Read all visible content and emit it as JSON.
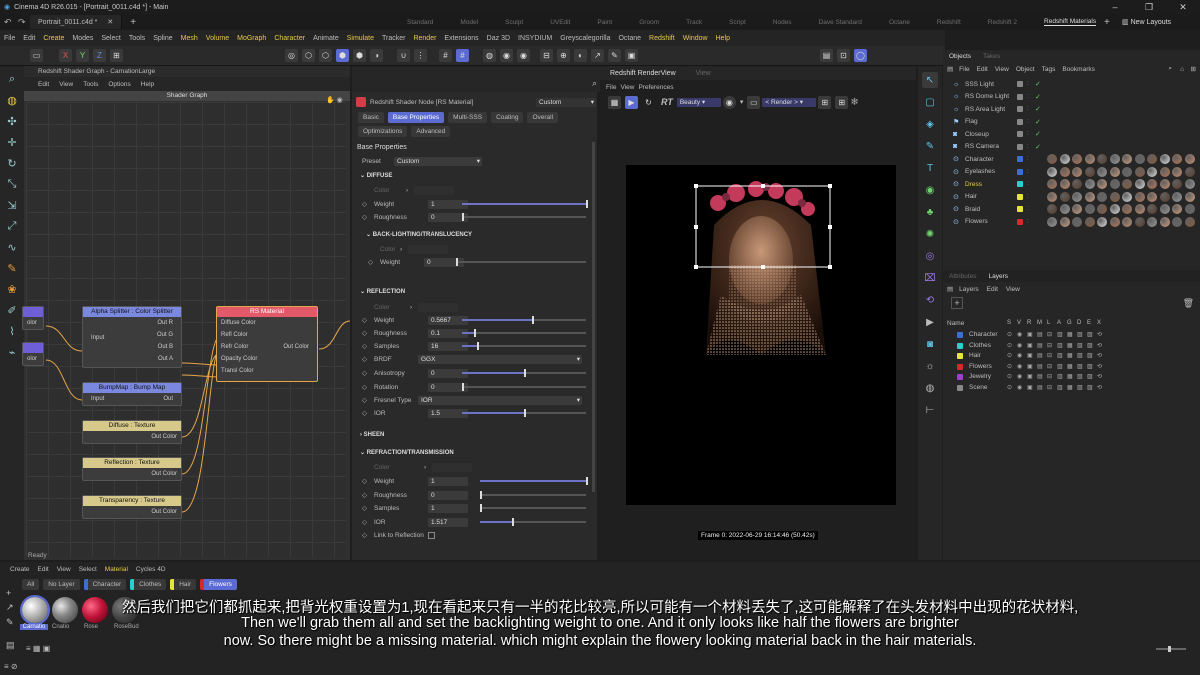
{
  "window": {
    "app_title": "Cinema 4D R26.015 - [Portrait_0011.c4d *] - Main",
    "doc_tab": "Portrait_0011.c4d *"
  },
  "layouts": [
    "Standard",
    "Model",
    "Sculpt",
    "UVEdit",
    "Paint",
    "Groom",
    "Track",
    "Script",
    "Nodes",
    "Dave Standard",
    "Octane",
    "Redshift",
    "Redshift 2",
    "Redshift Materials"
  ],
  "new_layouts": "New Layouts",
  "menubar": [
    "File",
    "Edit",
    "Create",
    "Modes",
    "Select",
    "Tools",
    "Spline",
    "Mesh",
    "Volume",
    "MoGraph",
    "Character",
    "Animate",
    "Simulate",
    "Tracker",
    "Render",
    "Extensions",
    "Daz 3D",
    "INSYDIUM",
    "Greyscalegorilla",
    "Octane",
    "Redshift",
    "Window",
    "Help"
  ],
  "toolbar": {
    "x": "X",
    "y": "Y",
    "z": "Z"
  },
  "shader_graph": {
    "header": "Redshift Shader Graph - CarnationLarge",
    "menu": [
      "Edit",
      "View",
      "Tools",
      "Options",
      "Help"
    ],
    "title": "Shader Graph",
    "nodes": {
      "splitter": {
        "title": "Alpha Splitter : Color Splitter",
        "input": "Input",
        "outs": [
          "Out R",
          "Out G",
          "Out B",
          "Out A"
        ]
      },
      "rsmat": {
        "title": "RS Material",
        "ins": [
          "Diffuse Color",
          "Refl Color",
          "Refr Color",
          "Opacity Color",
          "Transl Color"
        ],
        "out": "Out Color"
      },
      "bump": {
        "title": "BumpMap : Bump Map",
        "input": "Input",
        "out": "Out"
      },
      "diffuse": {
        "title": "Diffuse : Texture",
        "out": "Out Color"
      },
      "reflection": {
        "title": "Reflection : Texture",
        "out": "Out Color"
      },
      "transparency": {
        "title": "Transparency : Texture",
        "out": "Out Color"
      }
    },
    "partial_left": [
      "olor",
      "olor"
    ],
    "status": "Ready"
  },
  "attrs": {
    "node_title": "Redshift Shader Node [RS Material]",
    "preset_mode": "Custom",
    "tabs": [
      "Basic",
      "Base Properties",
      "Multi-SSS",
      "Coating",
      "Overall"
    ],
    "tabs2": [
      "Optimizations",
      "Advanced"
    ],
    "section": "Base Properties",
    "preset_label": "Preset",
    "preset_value": "Custom",
    "diffuse": {
      "head": "DIFFUSE",
      "color": "Color",
      "weight_label": "Weight",
      "weight": "1",
      "weight_frac": 1.0,
      "rough_label": "Roughness",
      "rough": "0",
      "rough_frac": 0.0
    },
    "backlight": {
      "head": "BACK-LIGHTING/TRANSLUCENCY",
      "color": "Color",
      "weight_label": "Weight",
      "weight": "0",
      "weight_frac": 0.0
    },
    "reflection": {
      "head": "REFLECTION",
      "color": "Color",
      "weight_label": "Weight",
      "weight": "0.5667",
      "weight_frac": 0.5667,
      "rough_label": "Roughness",
      "rough": "0.1",
      "rough_frac": 0.1,
      "samples_label": "Samples",
      "samples": "16",
      "samples_frac": 0.12,
      "brdf_label": "BRDF",
      "brdf": "GGX",
      "aniso_label": "Anisotropy",
      "aniso": "0",
      "aniso_frac": 0.5,
      "rot_label": "Rotation",
      "rot": "0",
      "rot_frac": 0.0,
      "fresnel_label": "Fresnel Type",
      "fresnel": "IOR",
      "ior_label": "IOR",
      "ior": "1.5",
      "ior_frac": 0.5
    },
    "sheen": "SHEEN",
    "refraction": {
      "head": "REFRACTION/TRANSMISSION",
      "color": "Color",
      "weight_label": "Weight",
      "weight": "1",
      "weight_frac": 1.0,
      "rough_label": "Roughness",
      "rough": "0",
      "rough_frac": 0.0,
      "samples_label": "Samples",
      "samples": "1",
      "samples_frac": 0.0,
      "ior_label": "IOR",
      "ior": "1.517",
      "ior_frac": 0.3,
      "link_label": "Link to Reflection"
    }
  },
  "renderview": {
    "tabs": [
      "Redshift RenderView",
      "View"
    ],
    "menu": [
      "File",
      "View",
      "Preferences"
    ],
    "rt": "RT",
    "aov": "Beauty",
    "camera": "< Render >",
    "frame_info": "Frame  0:  2022-06-29  16:14:46  (50.42s)"
  },
  "objects": {
    "tabs": [
      "Objects",
      "Takes"
    ],
    "menu": [
      "File",
      "Edit",
      "View",
      "Object",
      "Tags",
      "Bookmarks"
    ],
    "items": [
      {
        "name": "SSS Light",
        "color": "#888888"
      },
      {
        "name": "RS Dome Light",
        "color": "#888888"
      },
      {
        "name": "RS Area Light",
        "color": "#888888"
      },
      {
        "name": "Flag",
        "color": "#888888"
      },
      {
        "name": "Closeup",
        "color": "#888888"
      },
      {
        "name": "RS Camera",
        "color": "#888888"
      },
      {
        "name": "Character",
        "color": "#3b6fd6"
      },
      {
        "name": "Eyelashes",
        "color": "#3b6fd6"
      },
      {
        "name": "Dress",
        "color": "#2ad0d0",
        "highlight": true
      },
      {
        "name": "Hair",
        "color": "#e5e53a"
      },
      {
        "name": "Braid",
        "color": "#e5e53a"
      },
      {
        "name": "Flowers",
        "color": "#d42a2a"
      }
    ]
  },
  "layers": {
    "tabs": [
      "Attributes",
      "Layers"
    ],
    "menu": [
      "Layers",
      "Edit",
      "View"
    ],
    "col_name": "Name",
    "cols": [
      "S",
      "V",
      "R",
      "M",
      "L",
      "A",
      "G",
      "D",
      "E",
      "X"
    ],
    "items": [
      {
        "name": "Character",
        "color": "#3b6fd6"
      },
      {
        "name": "Clothes",
        "color": "#2ad0d0"
      },
      {
        "name": "Hair",
        "color": "#e5e53a"
      },
      {
        "name": "Flowers",
        "color": "#d42a2a"
      },
      {
        "name": "Jewelry",
        "color": "#a040d0"
      },
      {
        "name": "Scene",
        "color": "#888888"
      }
    ]
  },
  "material_manager": {
    "menu": [
      "Create",
      "Edit",
      "View",
      "Select",
      "Material",
      "Cycles 4D"
    ],
    "filters": [
      "All",
      "No Layer",
      "Character",
      "Clothes",
      "Hair",
      "Flowers"
    ],
    "materials": [
      "Carnatio",
      "Cnatio",
      "Rose",
      "RoseBud"
    ]
  },
  "subtitles": {
    "zh": "然后我们把它们都抓起来,把背光权重设置为1,现在看起来只有一半的花比较亮,所以可能有一个材料丢失了,这可能解释了在头发材料中出现的花状材料,",
    "en1": "Then we'll grab them all and set the backlighting weight to one. And it only looks like half the flowers are brighter",
    "en2": "now. So there might be a missing material. which might explain the flowery looking material back in the hair materials."
  }
}
